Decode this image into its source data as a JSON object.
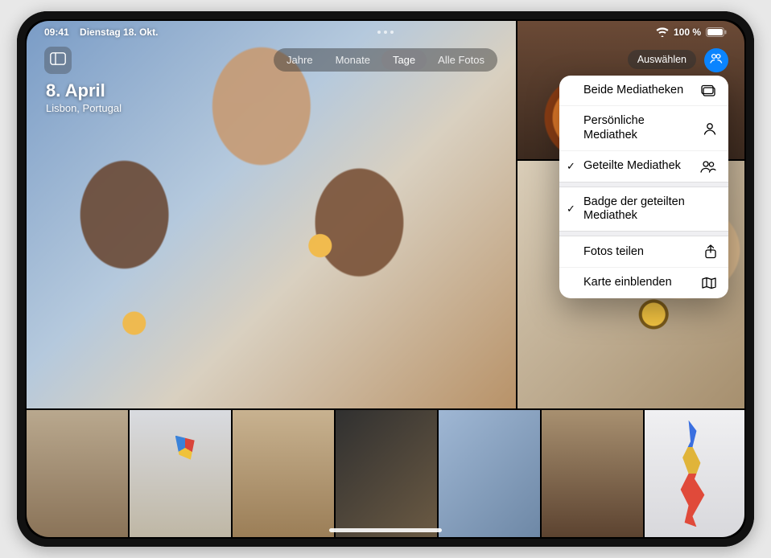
{
  "statusbar": {
    "time": "09:41",
    "date": "Dienstag 18. Okt.",
    "battery_text": "100 %"
  },
  "header": {
    "date_title": "8. April",
    "location": "Lisbon, Portugal",
    "select_label": "Auswählen"
  },
  "segmented": {
    "items": [
      "Jahre",
      "Monate",
      "Tage",
      "Alle Fotos"
    ],
    "active_index": 2
  },
  "menu": {
    "items": [
      {
        "label": "Beide Mediatheken",
        "icon": "library-both-icon",
        "checked": false
      },
      {
        "label": "Persönliche Mediathek",
        "icon": "person-icon",
        "checked": false
      },
      {
        "label": "Geteilte Mediathek",
        "icon": "people-icon",
        "checked": true
      }
    ],
    "badge_item": {
      "label": "Badge der geteilten Mediathek",
      "checked": true
    },
    "actions": [
      {
        "label": "Fotos teilen",
        "icon": "share-icon"
      },
      {
        "label": "Karte einblenden",
        "icon": "map-icon"
      }
    ]
  }
}
